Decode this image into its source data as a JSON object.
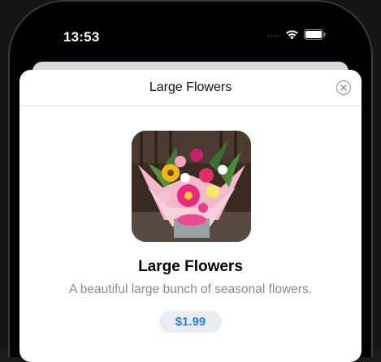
{
  "status_bar": {
    "time": "13:53",
    "signal": "····",
    "wifi_icon": "wifi-icon",
    "battery_icon": "battery-icon"
  },
  "sheet": {
    "title": "Large Flowers",
    "close_icon": "close-circle-icon"
  },
  "product": {
    "image_subject": "flower-bouquet",
    "name": "Large Flowers",
    "description": "A beautiful large bunch of seasonal flowers.",
    "price": "$1.99"
  },
  "colors": {
    "accent": "#2e7be0",
    "price_badge_bg": "#e9ecf1",
    "secondary_text": "#8a8a8e"
  }
}
